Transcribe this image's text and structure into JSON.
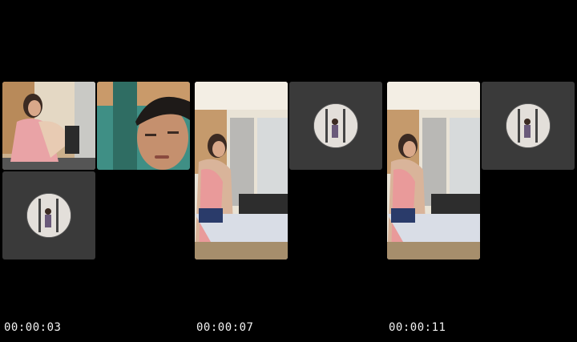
{
  "frames": [
    {
      "timestamp": "00:00:03"
    },
    {
      "timestamp": "00:00:07"
    },
    {
      "timestamp": "00:00:11"
    }
  ]
}
